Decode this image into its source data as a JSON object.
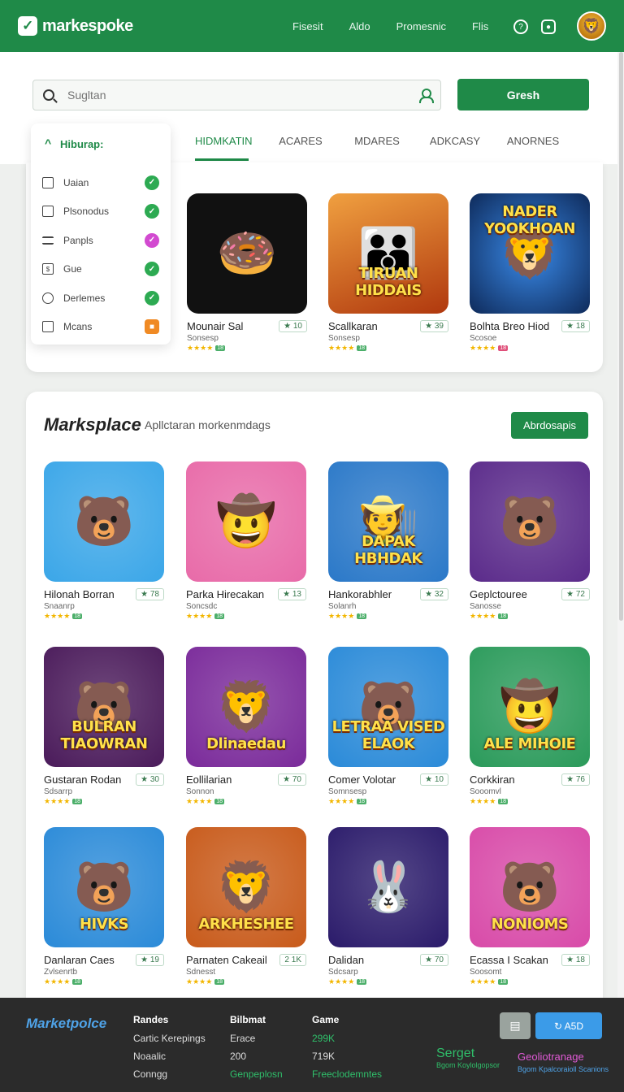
{
  "header": {
    "brand": "markespoke",
    "nav": [
      "Fisesit",
      "Aldo",
      "Promesnic",
      "Flis"
    ],
    "help_glyph": "?",
    "chat_glyph": "●",
    "avatar_glyph": "🦁"
  },
  "search": {
    "placeholder": "Sugltan",
    "button": "Gresh"
  },
  "tabs": [
    "HIDMKATIN",
    "ACARES",
    "MDARES",
    "ADKCASY",
    "ANORNES"
  ],
  "sidebar": {
    "title": "Hiburap:",
    "items": [
      {
        "label": "Uaian",
        "icon": "inbox-icon",
        "status_color": "#2daa52",
        "glyph": "✓"
      },
      {
        "label": "Plsonodus",
        "icon": "square-icon",
        "status_color": "#2daa52",
        "glyph": "✓"
      },
      {
        "label": "Panpls",
        "icon": "menu-icon",
        "status_color": "#d24ad0",
        "glyph": "✓"
      },
      {
        "label": "Gue",
        "icon": "dollar-icon",
        "status_color": "#2daa52",
        "glyph": "✓"
      },
      {
        "label": "Derlemes",
        "icon": "user-icon",
        "status_color": "#2daa52",
        "glyph": "✓"
      },
      {
        "label": "Mcans",
        "icon": "folder-icon",
        "status_color": "#f08a24",
        "glyph": "■"
      }
    ]
  },
  "featured": [
    {
      "name": "Mounair Sal",
      "badge": "★ 10",
      "category": "Sonsesp",
      "bg": "#111",
      "glyph": "🍩",
      "word": ""
    },
    {
      "name": "Scallkaran",
      "badge": "★ 39",
      "category": "Sonsesp",
      "bg": "#c8521a",
      "glyph": "👪",
      "word": "TIRUAN HIDDAIS"
    },
    {
      "name": "Bolhta Breo Hiod",
      "badge": "★ 18",
      "category": "Scosoe",
      "bg": "#1a4a8a",
      "glyph": "🦁",
      "word": "NADER YOOKHOAN"
    }
  ],
  "marketplace": {
    "title": "Marksplace",
    "subtitle": "Apllctaran morkenmdags",
    "button": "Abrdosapis",
    "apps": [
      {
        "name": "Hilonah Borran",
        "badge": "★ 78",
        "category": "Snaanrp",
        "bg": "#3aa6e8",
        "glyph": "🐻",
        "word": ""
      },
      {
        "name": "Parka Hirecakan",
        "badge": "★ 13",
        "category": "Soncsdc",
        "bg": "#e86aa8",
        "glyph": "🤠",
        "word": ""
      },
      {
        "name": "Hankorabhler",
        "badge": "★ 32",
        "category": "Solanrh",
        "bg": "#2a78c8",
        "glyph": "🧑‍🌾",
        "word": "DAPAK HBHDAK"
      },
      {
        "name": "Geplctouree",
        "badge": "★ 72",
        "category": "Sanosse",
        "bg": "#5a2a8a",
        "glyph": "🐻",
        "word": ""
      },
      {
        "name": "Gustaran Rodan",
        "badge": "★ 30",
        "category": "Sdsarrp",
        "bg": "#4a1a5a",
        "glyph": "🐻",
        "word": "BULRAN TIAOWRAN"
      },
      {
        "name": "Eollilarian",
        "badge": "★ 70",
        "category": "Sonnon",
        "bg": "#7a2a9a",
        "glyph": "🦁",
        "word": "Dlinaedau"
      },
      {
        "name": "Comer Volotar",
        "badge": "★ 10",
        "category": "Somnsesp",
        "bg": "#2a8ad8",
        "glyph": "🐻",
        "word": "LETRAA VISED ELAOK"
      },
      {
        "name": "Corkkiran",
        "badge": "★ 76",
        "category": "Sooomvl",
        "bg": "#2a9a5a",
        "glyph": "🤠",
        "word": "ALE MIHOIE"
      },
      {
        "name": "Danlaran Caes",
        "badge": "★ 19",
        "category": "Zvlsenrtb",
        "bg": "#2a8ad8",
        "glyph": "🐻",
        "word": "HIVKS"
      },
      {
        "name": "Parnaten Cakeail",
        "badge": "2 1K",
        "category": "Sdnesst",
        "bg": "#c85a1a",
        "glyph": "🦁",
        "word": "ARKHESHEE"
      },
      {
        "name": "Dalidan",
        "badge": "★ 70",
        "category": "Sdcsarp",
        "bg": "#2a1a6a",
        "glyph": "🐰",
        "word": ""
      },
      {
        "name": "Ecassa I Scakan",
        "badge": "★ 18",
        "category": "Soosomt",
        "bg": "#d84aa8",
        "glyph": "🐻",
        "word": "NONIOMS"
      }
    ]
  },
  "footer": {
    "brand": "Marketpolce",
    "col1": {
      "title": "Randes",
      "items": [
        "Cartic Kerepings",
        "Noaalic",
        "Conngg"
      ]
    },
    "col2": {
      "title": "Bilbmat",
      "items": [
        "Erace",
        "200",
        "Genpeplosn"
      ]
    },
    "col3": {
      "title": "Game",
      "items": [
        "299K",
        "719K",
        "Freeclodemntes"
      ]
    },
    "btn_icon": "▤",
    "btn_label": "↻ A5D",
    "store1": {
      "label": "Serget",
      "sub": "Bgom Koylolgopsor"
    },
    "store2": {
      "label": "Geoliotranage",
      "sub": "Bgom Kpalcoraioll Scanions"
    }
  },
  "colors": {
    "brand": "#1f8a48",
    "footer": "#2b2b2b",
    "accent_blue": "#3b9be8"
  }
}
